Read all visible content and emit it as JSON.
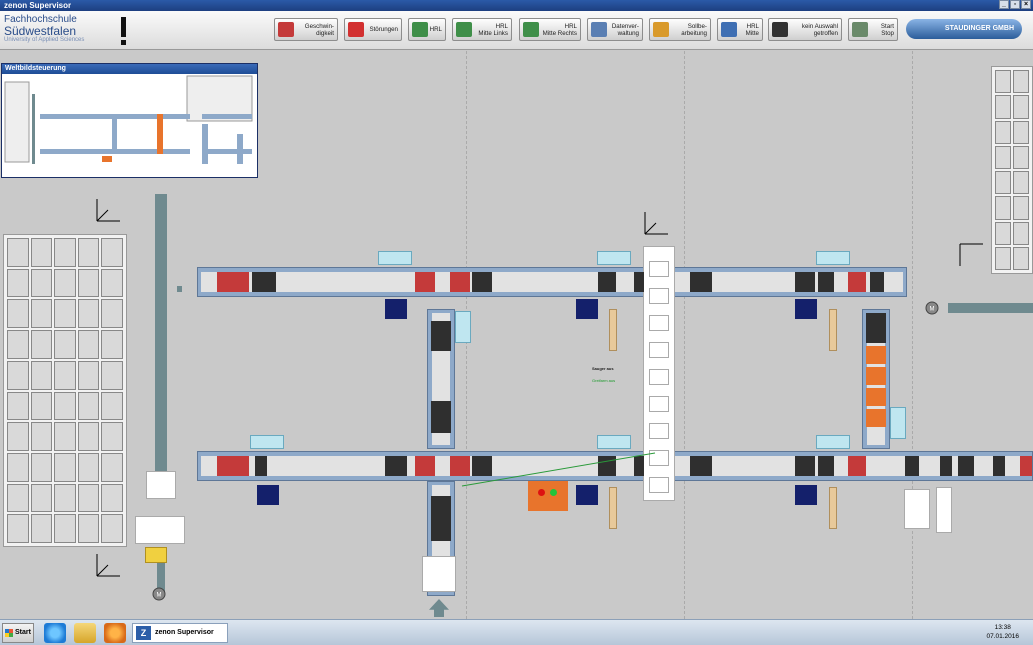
{
  "window": {
    "title": "zenon Supervisor"
  },
  "logo": {
    "line1": "Fachhochschule",
    "line2": "Südwestfalen",
    "line3": "University of Applied Sciences"
  },
  "toolbar": {
    "buttons": [
      {
        "label": "Geschwin-\ndigkeit",
        "icon": "speed-car-icon",
        "color": "#c43a3a"
      },
      {
        "label": "Störungen",
        "icon": "alarm-bell-icon",
        "color": "#d23030"
      },
      {
        "label": "HRL",
        "icon": "rack-icon",
        "color": "#3f8f49"
      },
      {
        "label": "HRL\nMitte Links",
        "icon": "rack-icon",
        "color": "#3f8f49"
      },
      {
        "label": "HRL\nMitte Rechts",
        "icon": "rack-icon",
        "color": "#3f8f49"
      },
      {
        "label": "Datenver-\nwaltung",
        "icon": "database-icon",
        "color": "#5a7fb3"
      },
      {
        "label": "Sollbe-\narbeitung",
        "icon": "worker-icon",
        "color": "#d99a2b"
      },
      {
        "label": "HRL\nMitte",
        "icon": "rack-icon",
        "color": "#3f6fb3"
      },
      {
        "label": "kein Auswahl\ngetroffen",
        "icon": "clapper-icon",
        "color": "#333333"
      },
      {
        "label": "Start\nStop",
        "icon": "gear-play-icon",
        "color": "#6a8a6a"
      }
    ],
    "brand": "STAUDINGER GMBH"
  },
  "minimap": {
    "title": "Weltbildsteuerung"
  },
  "process": {
    "storage_label": "Sauger aus",
    "storage_sub": "Greifarm aus"
  },
  "taskbar": {
    "start_label": "Start",
    "task_label": "zenon Supervisor",
    "time": "13:38",
    "date": "07.01.2016"
  }
}
